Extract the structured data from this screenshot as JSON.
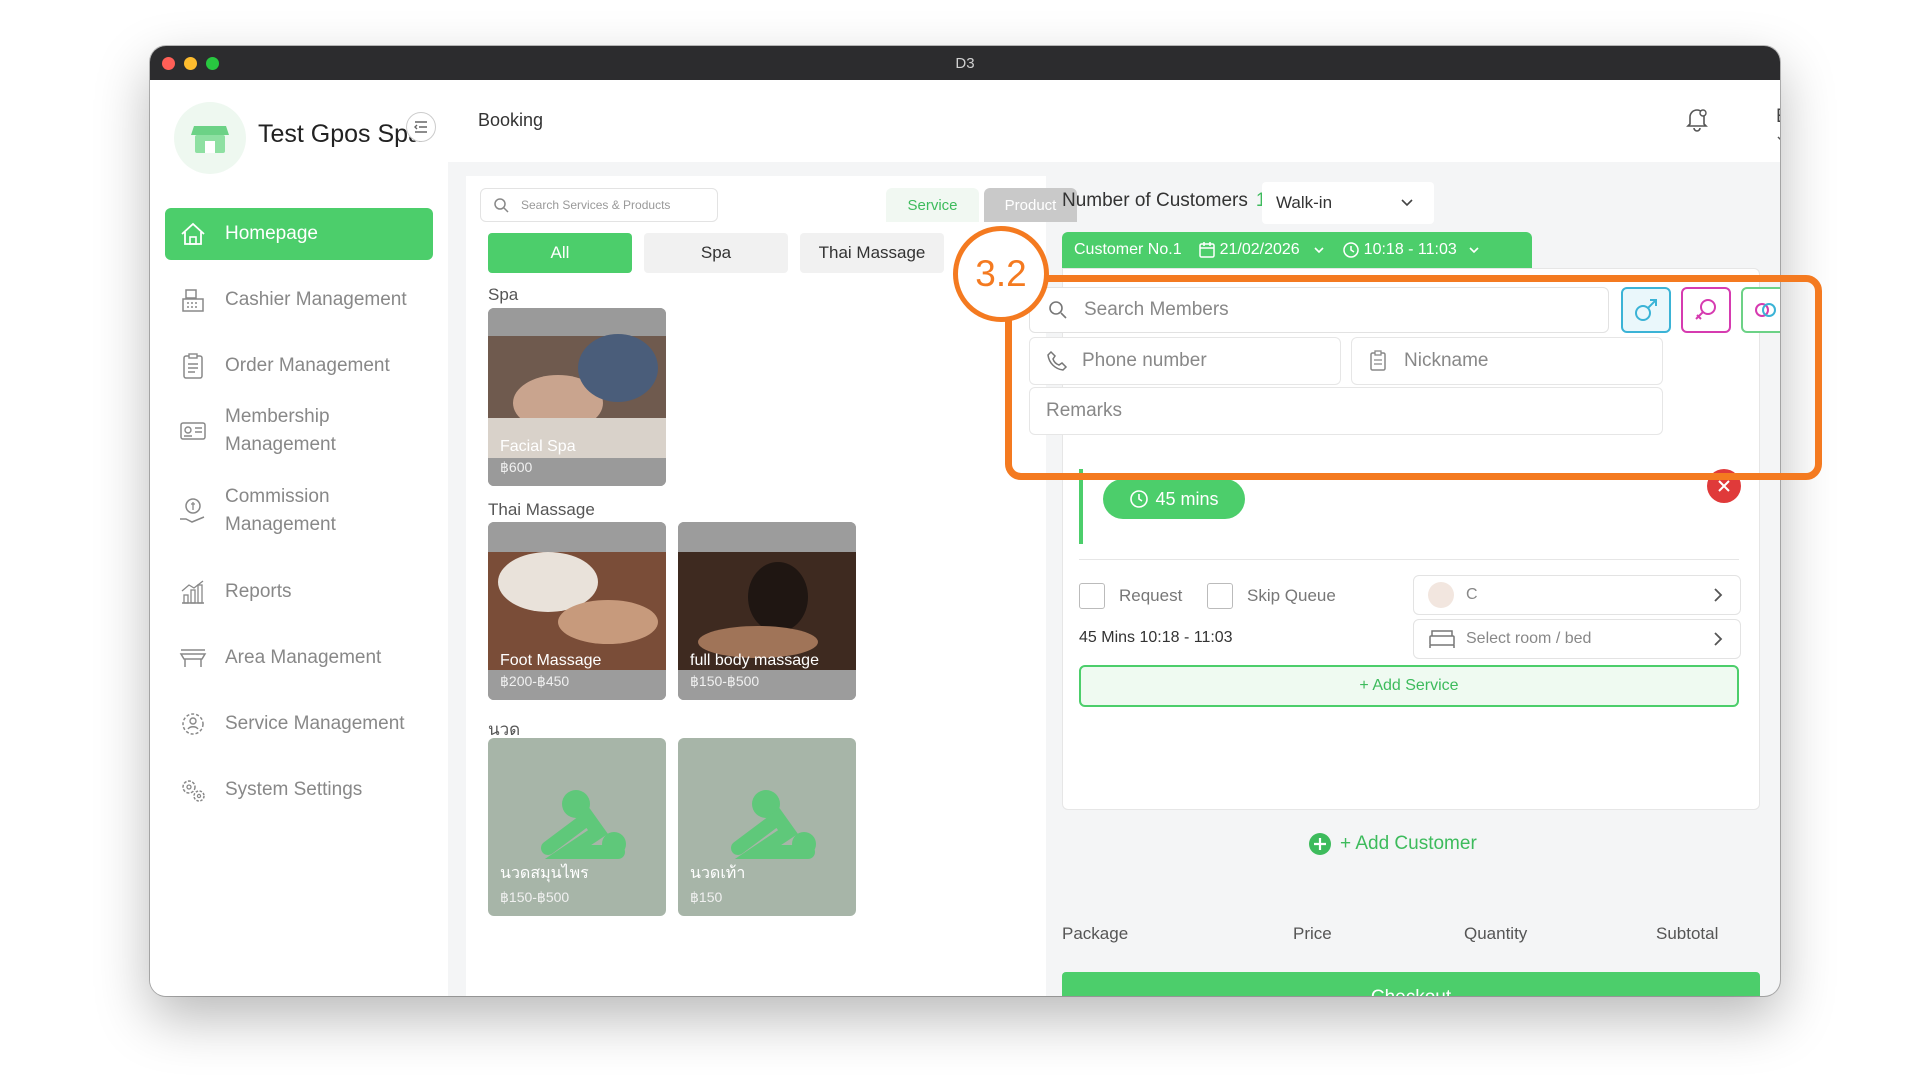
{
  "window": {
    "title": "D3"
  },
  "sidebar": {
    "store_name": "Test Gpos Spa",
    "items": [
      {
        "label": "Homepage",
        "icon": "home-icon",
        "active": true
      },
      {
        "label": "Cashier Management",
        "icon": "cashier-icon"
      },
      {
        "label": "Order Management",
        "icon": "clipboard-icon"
      },
      {
        "label": "Membership Management",
        "line1": "Membership",
        "line2": "Management",
        "icon": "membership-card-icon"
      },
      {
        "label": "Commission Management",
        "line1": "Commission",
        "line2": "Management",
        "icon": "commission-hand-icon"
      },
      {
        "label": "Reports",
        "icon": "chart-icon"
      },
      {
        "label": "Area Management",
        "icon": "bench-icon"
      },
      {
        "label": "Service Management",
        "icon": "service-badge-icon"
      },
      {
        "label": "System Settings",
        "icon": "gears-icon"
      }
    ]
  },
  "header": {
    "title": "Booking",
    "language": "EN"
  },
  "catalog": {
    "search_placeholder": "Search Services & Products",
    "tabs": {
      "service": "Service",
      "product": "Product"
    },
    "categories": [
      "All",
      "Spa",
      "Thai Massage"
    ],
    "sections": [
      {
        "title": "Spa",
        "items": [
          {
            "name": "Facial Spa",
            "price": "฿600"
          }
        ]
      },
      {
        "title": "Thai Massage",
        "items": [
          {
            "name": "Foot Massage",
            "price": "฿200-฿450"
          },
          {
            "name": "full body massage",
            "price": "฿150-฿500"
          }
        ]
      },
      {
        "title": "นวด",
        "items": [
          {
            "name": "นวดสมุนไพร",
            "price": "฿150-฿500"
          },
          {
            "name": "นวดเท้า",
            "price": "฿150"
          }
        ]
      }
    ]
  },
  "booking": {
    "customers_label": "Number of Customers",
    "customers_count": "1",
    "source": "Walk-in",
    "customer_tab": {
      "label": "Customer No.1",
      "date": "21/02/2026",
      "time": "10:18 - 11:03"
    },
    "search_members_placeholder": "Search Members",
    "phone_placeholder": "Phone number",
    "nickname_placeholder": "Nickname",
    "remarks_placeholder": "Remarks",
    "duration": "45 mins",
    "request_label": "Request",
    "skip_queue_label": "Skip Queue",
    "therapist": "C",
    "time_info": "45 Mins  10:18 - 11:03",
    "room_placeholder": "Select room / bed",
    "add_service": "+ Add Service",
    "add_customer": "+ Add Customer",
    "table_headers": [
      "Package",
      "Price",
      "Quantity",
      "Subtotal"
    ],
    "checkout": "Checkout"
  },
  "annotation": {
    "step": "3.2",
    "color": "#f47a20"
  },
  "colors": {
    "accent": "#4cce6b",
    "danger": "#e03a3a",
    "male": "#3bb3d6",
    "female": "#d63bb0"
  }
}
